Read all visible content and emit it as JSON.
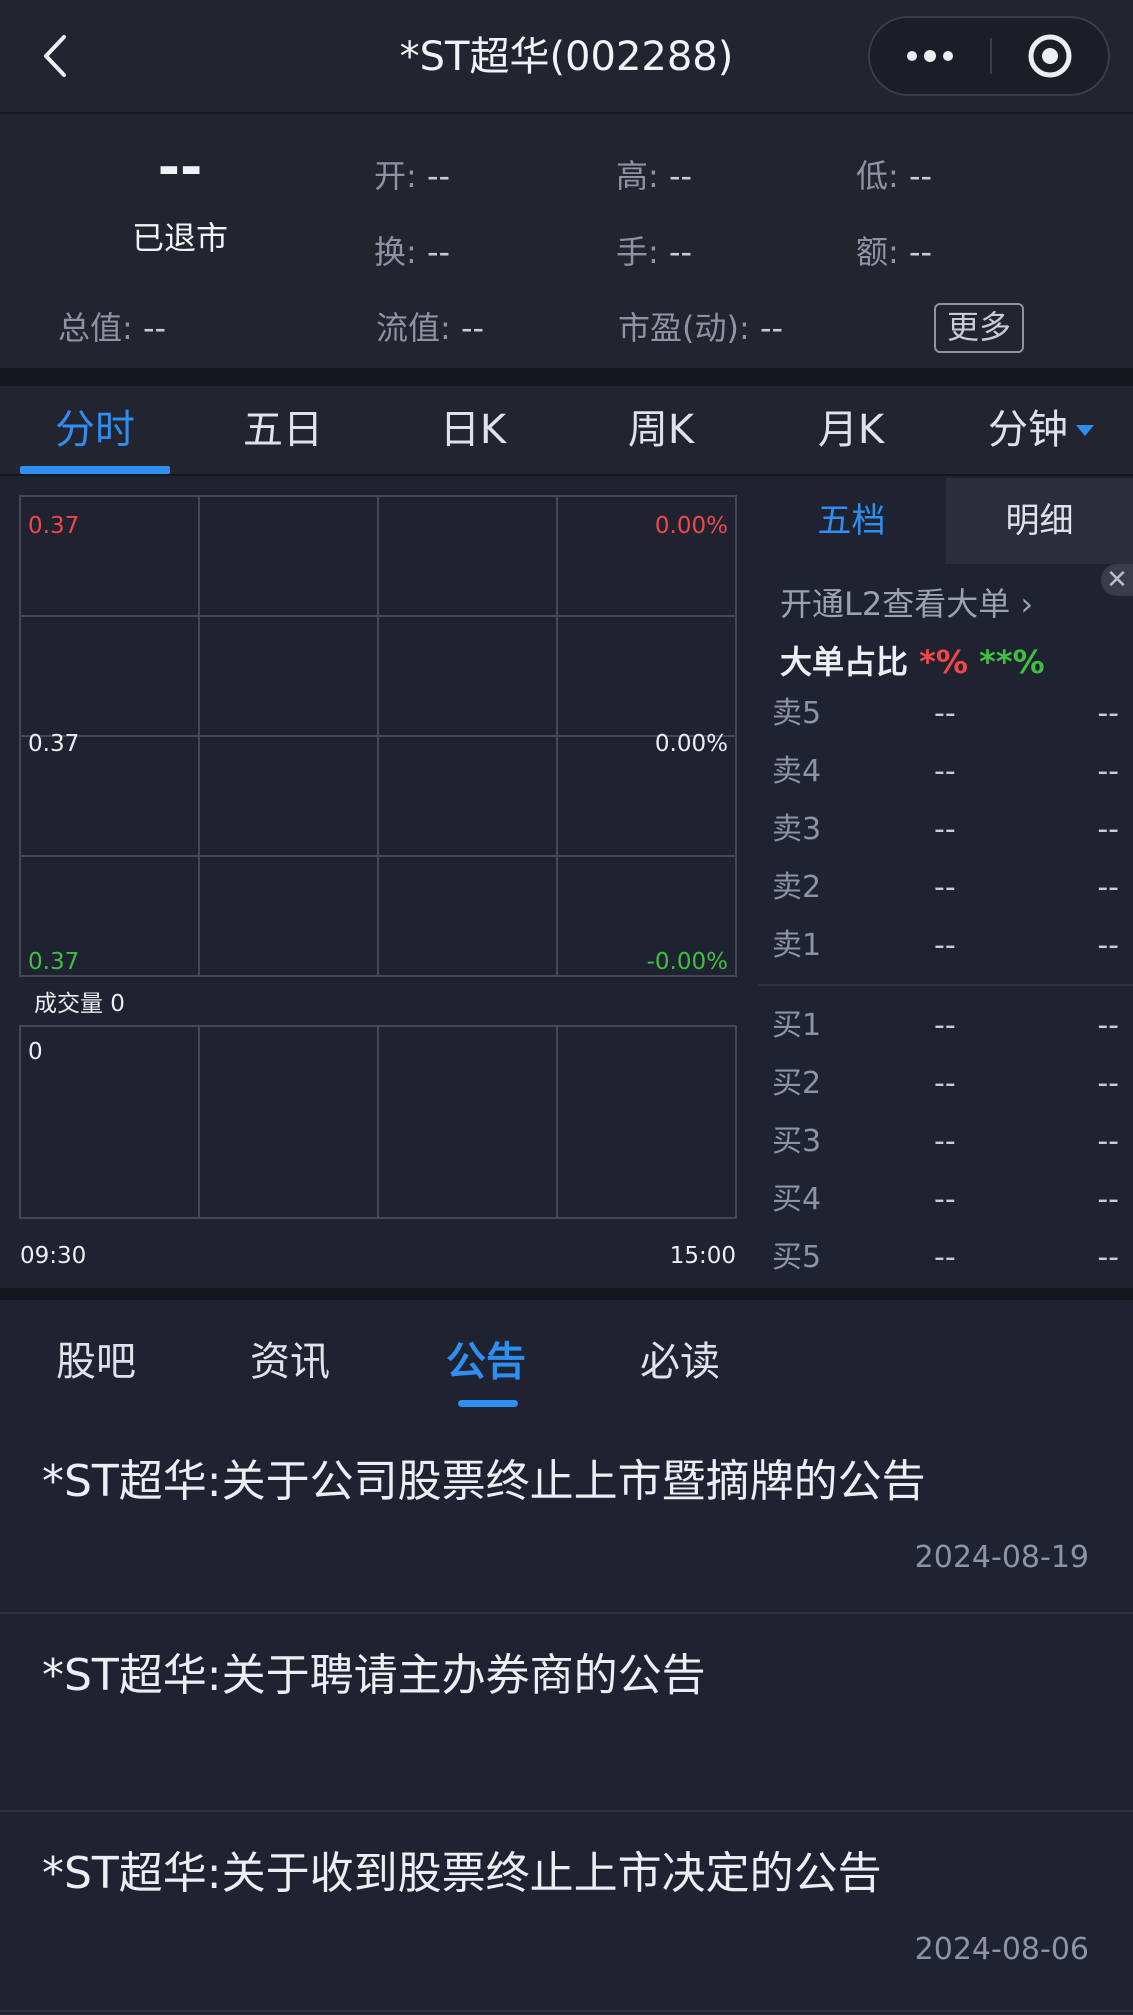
{
  "header": {
    "title": "*ST超华(002288)",
    "back_icon": "chevron-left-icon",
    "more_icon": "more-dots-icon",
    "target_icon": "target-icon"
  },
  "quote": {
    "price": "--",
    "status": "已退市",
    "items": [
      {
        "label": "开:",
        "value": "--"
      },
      {
        "label": "高:",
        "value": "--"
      },
      {
        "label": "低:",
        "value": "--"
      },
      {
        "label": "换:",
        "value": "--"
      },
      {
        "label": "手:",
        "value": "--"
      },
      {
        "label": "额:",
        "value": "--"
      },
      {
        "label": "总值:",
        "value": "--"
      },
      {
        "label": "流值:",
        "value": "--"
      },
      {
        "label": "市盈(动):",
        "value": "--"
      }
    ],
    "more_label": "更多"
  },
  "chart_tabs": [
    "分时",
    "五日",
    "日K",
    "周K",
    "月K",
    "分钟"
  ],
  "chart": {
    "price_top": "0.37",
    "price_mid": "0.37",
    "price_bot": "0.37",
    "pct_top": "0.00%",
    "pct_mid": "0.00%",
    "pct_bot": "-0.00%",
    "volume_label": "成交量 0",
    "volume_axis": "0",
    "time_start": "09:30",
    "time_end": "15:00"
  },
  "order_book": {
    "tabs": [
      "五档",
      "明细"
    ],
    "close_label": "✕",
    "l2_link": "开通L2查看大单 ›",
    "big_ratio_label": "大单占比",
    "big_ratio_red": "*%",
    "big_ratio_green": "**%",
    "sells": [
      {
        "label": "卖5",
        "price": "--",
        "qty": "--"
      },
      {
        "label": "卖4",
        "price": "--",
        "qty": "--"
      },
      {
        "label": "卖3",
        "price": "--",
        "qty": "--"
      },
      {
        "label": "卖2",
        "price": "--",
        "qty": "--"
      },
      {
        "label": "卖1",
        "price": "--",
        "qty": "--"
      }
    ],
    "buys": [
      {
        "label": "买1",
        "price": "--",
        "qty": "--"
      },
      {
        "label": "买2",
        "price": "--",
        "qty": "--"
      },
      {
        "label": "买3",
        "price": "--",
        "qty": "--"
      },
      {
        "label": "买4",
        "price": "--",
        "qty": "--"
      },
      {
        "label": "买5",
        "price": "--",
        "qty": "--"
      }
    ]
  },
  "info_tabs": [
    "股吧",
    "资讯",
    "公告",
    "必读"
  ],
  "news": [
    {
      "title": "*ST超华:关于公司股票终止上市暨摘牌的公告",
      "date": "2024-08-19"
    },
    {
      "title": "*ST超华:关于聘请主办券商的公告",
      "date": ""
    },
    {
      "title": "*ST超华:关于收到股票终止上市决定的公告",
      "date": "2024-08-06"
    }
  ],
  "colors": {
    "accent": "#2f8ff0",
    "up": "#f04848",
    "down": "#3fbf3f",
    "background": "#1f2230"
  }
}
